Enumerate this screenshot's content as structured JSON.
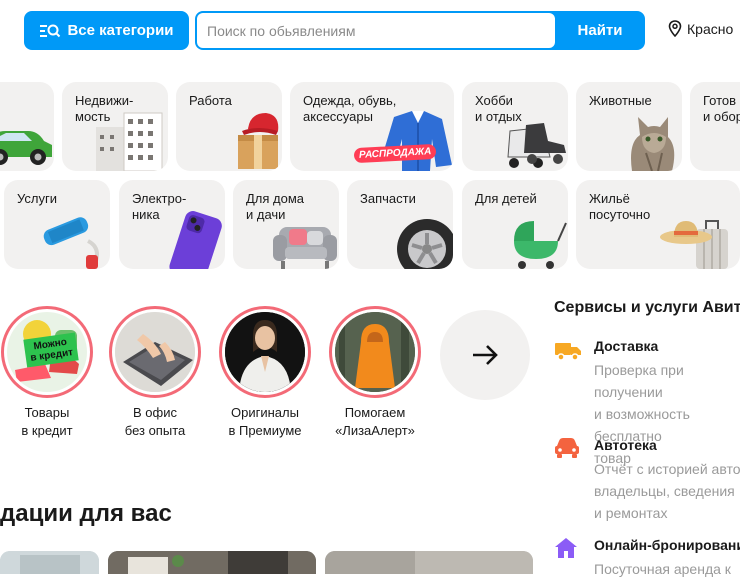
{
  "header": {
    "categories_label": "Все категории",
    "search_placeholder": "Поиск по обьявлениям",
    "search_button": "Найти",
    "location": "Красно"
  },
  "categories": [
    {
      "label": "Недвижи-\nмость"
    },
    {
      "label": "Работа"
    },
    {
      "label": "Одежда, обувь,\nаксессуары",
      "badge": "РАСПРОДАЖА"
    },
    {
      "label": "Хобби\nи отдых"
    },
    {
      "label": "Животные"
    },
    {
      "label": "Готов\nи обор"
    },
    {
      "label": "Услуги"
    },
    {
      "label": "Электро-\nника"
    },
    {
      "label": "Для дома\nи дачи"
    },
    {
      "label": "Запчасти"
    },
    {
      "label": "Для детей"
    },
    {
      "label": "Жильё\nпосуточно"
    }
  ],
  "stories": [
    {
      "caption": "Товары\nв кредит",
      "sticker": "Можно\nв кредит"
    },
    {
      "caption": "В офис\nбез опыта"
    },
    {
      "caption": "Оригиналы\nв Премиуме"
    },
    {
      "caption": "Помогаем\n«ЛизаАлерт»"
    }
  ],
  "services": {
    "title": "Сервисы и услуги Авито",
    "items": [
      {
        "name": "Доставка",
        "desc": "Проверка при получении\nи возможность бесплатно\nтовар",
        "icon": "truck-icon",
        "color": "#f7a823"
      },
      {
        "name": "Автотека",
        "desc": "Отчёт с историей авто\nвладельцы, сведения\nи ремонтах",
        "icon": "car-icon",
        "color": "#f4633f"
      },
      {
        "name": "Онлайн-бронирование",
        "desc": "Посуточная аренда к",
        "icon": "house-icon",
        "color": "#8b5cf6"
      }
    ]
  },
  "recommendations": {
    "title": "дации для вас"
  },
  "colors": {
    "accent": "#0099f7",
    "tile_bg": "#f2f1f0",
    "story_ring": "#f36a77"
  }
}
